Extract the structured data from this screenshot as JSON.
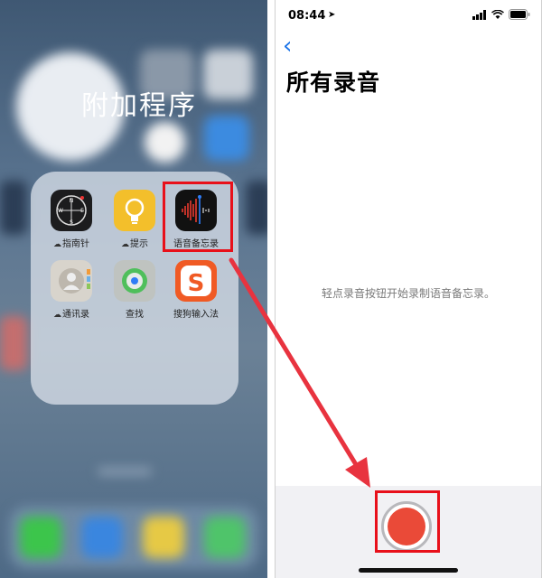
{
  "left_panel": {
    "folder_title": "附加程序",
    "apps": [
      {
        "label": "指南针",
        "icon": "compass-icon",
        "cloud": true
      },
      {
        "label": "提示",
        "icon": "tips-icon",
        "cloud": true
      },
      {
        "label": "语音备忘录",
        "icon": "voice-memos-icon",
        "cloud": false
      },
      {
        "label": "通讯录",
        "icon": "contacts-icon",
        "cloud": true
      },
      {
        "label": "查找",
        "icon": "find-my-icon",
        "cloud": false
      },
      {
        "label": "搜狗输入法",
        "icon": "sogou-input-icon",
        "cloud": false
      }
    ],
    "highlight_color": "#e8101a"
  },
  "right_panel": {
    "status": {
      "time": "08:44",
      "location_glyph": "➤"
    },
    "back_glyph": "‹",
    "title": "所有录音",
    "hint": "轻点录音按钮开始录制语音备忘录。",
    "record_color": "#ea4a38",
    "accent": "#1a73e8"
  },
  "annotation": {
    "arrow_color": "#e8333f"
  }
}
